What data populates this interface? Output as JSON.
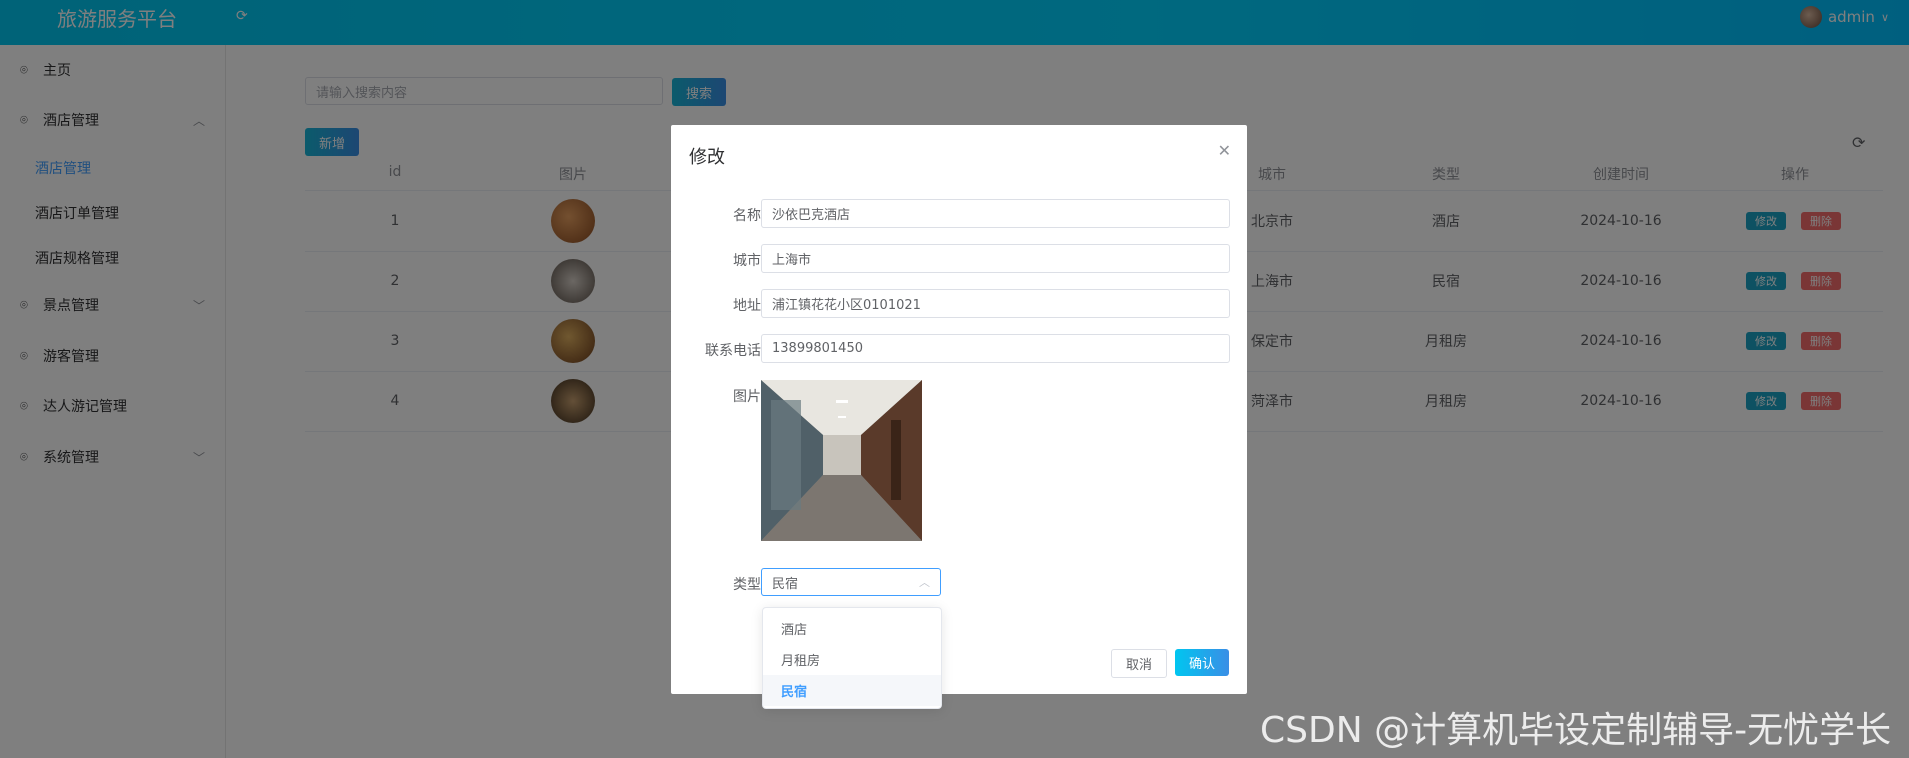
{
  "header": {
    "title": "旅游服务平台",
    "user": "admin"
  },
  "sidebar": {
    "items": [
      {
        "label": "主页"
      },
      {
        "label": "酒店管理"
      },
      {
        "label": "景点管理"
      },
      {
        "label": "游客管理"
      },
      {
        "label": "达人游记管理"
      },
      {
        "label": "系统管理"
      }
    ],
    "sub_items": [
      {
        "label": "酒店管理"
      },
      {
        "label": "酒店订单管理"
      },
      {
        "label": "酒店规格管理"
      }
    ]
  },
  "toolbar": {
    "search_placeholder": "请输入搜索内容",
    "search_label": "搜索",
    "add_label": "新增"
  },
  "table": {
    "headers": [
      "id",
      "图片",
      "城市",
      "类型",
      "创建时间",
      "操作"
    ],
    "rows": [
      {
        "id": "1",
        "city": "北京市",
        "type": "酒店",
        "created": "2024-10-16"
      },
      {
        "id": "2",
        "city": "上海市",
        "type": "民宿",
        "created": "2024-10-16"
      },
      {
        "id": "3",
        "city": "保定市",
        "type": "月租房",
        "created": "2024-10-16"
      },
      {
        "id": "4",
        "city": "菏泽市",
        "type": "月租房",
        "created": "2024-10-16"
      }
    ],
    "edit_label": "修改",
    "delete_label": "删除"
  },
  "dialog": {
    "title": "修改",
    "fields": {
      "name_label": "名称",
      "name_value": "沙依巴克酒店",
      "city_label": "城市",
      "city_value": "上海市",
      "address_label": "地址",
      "address_value": "浦江镇花花小区0101021",
      "phone_label": "联系电话",
      "phone_value": "13899801450",
      "image_label": "图片",
      "type_label": "类型",
      "type_value": "民宿"
    },
    "cancel_label": "取消",
    "confirm_label": "确认"
  },
  "dropdown": {
    "options": [
      "酒店",
      "月租房",
      "民宿"
    ],
    "selected": "民宿"
  },
  "watermark": "CSDN @计算机毕设定制辅导-无忧学长"
}
